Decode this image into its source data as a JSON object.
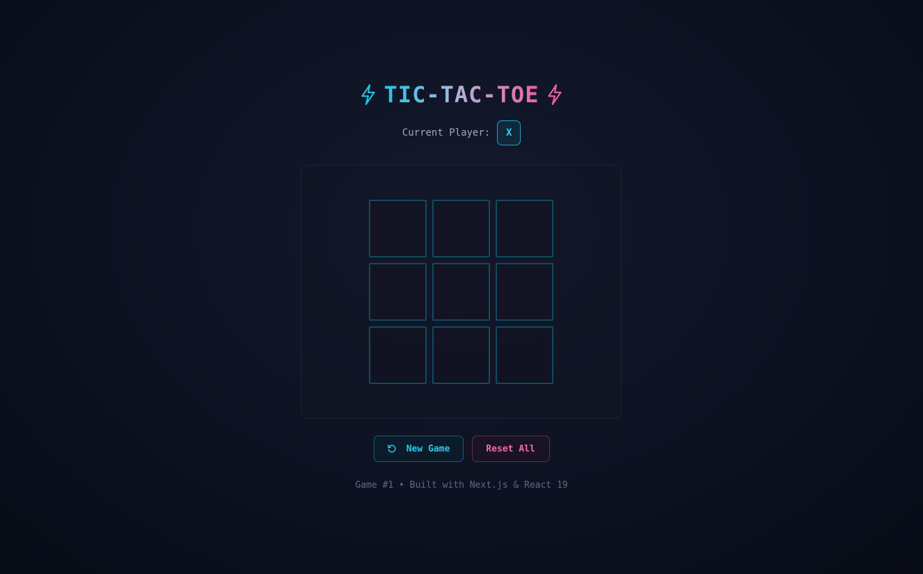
{
  "header": {
    "title": "TIC-TAC-TOE",
    "left_icon": "lightning-bolt-icon",
    "right_icon": "lightning-bolt-icon"
  },
  "status": {
    "label": "Current Player:",
    "current_player": "X"
  },
  "board": {
    "cells": [
      "",
      "",
      "",
      "",
      "",
      "",
      "",
      "",
      ""
    ]
  },
  "controls": {
    "new_game_label": "New Game",
    "new_game_icon": "refresh-icon",
    "reset_label": "Reset All"
  },
  "footer": {
    "text": "Game #1 • Built with Next.js & React 19"
  },
  "colors": {
    "accent_cyan": "#22c3ea",
    "accent_pink": "#f061a6",
    "background": "#0e1424"
  }
}
